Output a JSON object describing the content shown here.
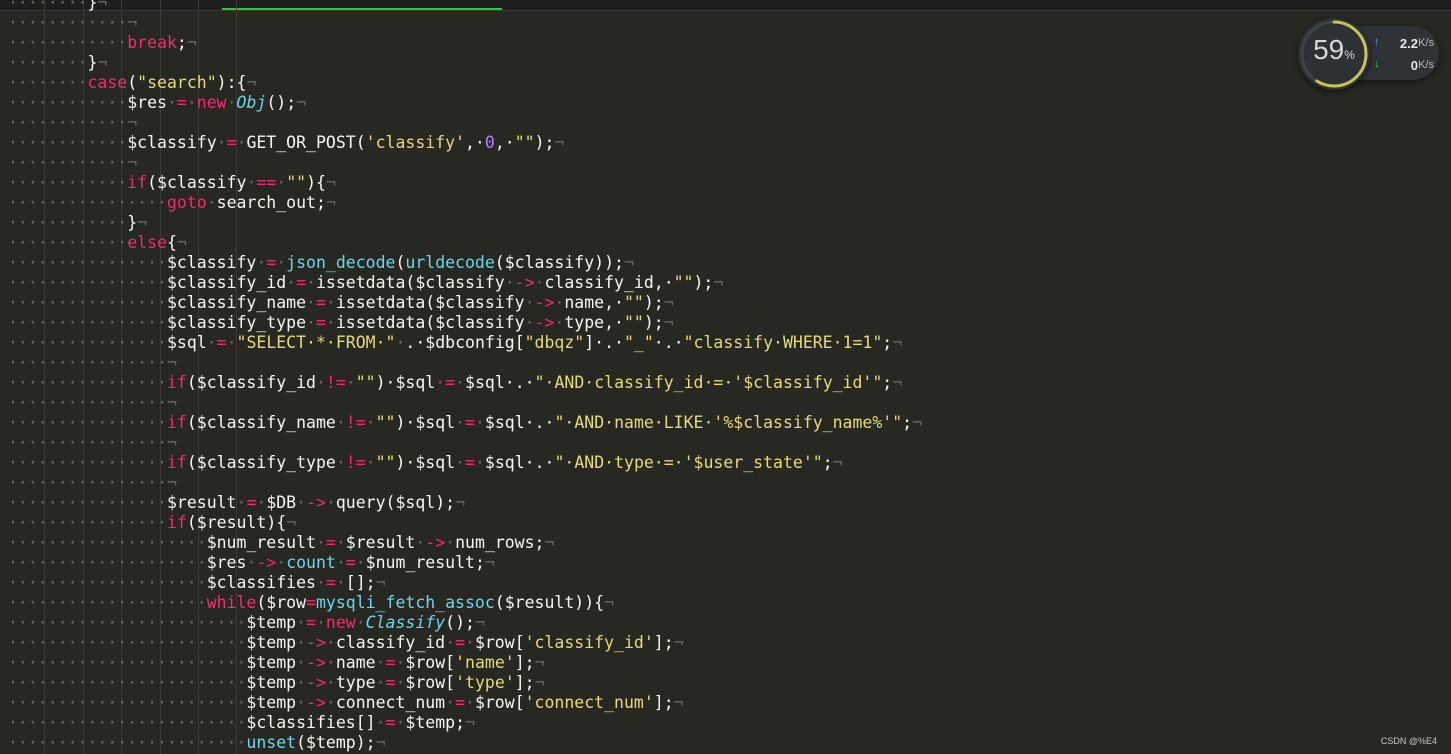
{
  "editor": {
    "lines": [
      {
        "indent": 2,
        "tokens": [
          [
            "plain",
            "}"
          ]
        ]
      },
      {
        "indent": 3,
        "tokens": []
      },
      {
        "indent": 3,
        "tokens": [
          [
            "kw",
            "break"
          ],
          [
            "plain",
            ";"
          ]
        ]
      },
      {
        "indent": 2,
        "tokens": [
          [
            "plain",
            "}"
          ]
        ]
      },
      {
        "indent": 2,
        "tokens": [
          [
            "kw",
            "case"
          ],
          [
            "plain",
            "("
          ],
          [
            "str",
            "\"search\""
          ],
          [
            "plain",
            "):{"
          ]
        ]
      },
      {
        "indent": 3,
        "tokens": [
          [
            "var",
            "$res"
          ],
          [
            "ws",
            "·"
          ],
          [
            "op",
            "="
          ],
          [
            "ws",
            "·"
          ],
          [
            "kw",
            "new"
          ],
          [
            "ws",
            "·"
          ],
          [
            "cls",
            "Obj"
          ],
          [
            "plain",
            "();"
          ]
        ]
      },
      {
        "indent": 3,
        "tokens": []
      },
      {
        "indent": 3,
        "tokens": [
          [
            "var",
            "$classify"
          ],
          [
            "ws",
            "·"
          ],
          [
            "op",
            "="
          ],
          [
            "ws",
            "·"
          ],
          [
            "plain",
            "GET_OR_POST("
          ],
          [
            "str",
            "'classify'"
          ],
          [
            "plain",
            ",·"
          ],
          [
            "num",
            "0"
          ],
          [
            "plain",
            ",·"
          ],
          [
            "str",
            "\"\""
          ],
          [
            "plain",
            ");"
          ]
        ]
      },
      {
        "indent": 3,
        "tokens": []
      },
      {
        "indent": 3,
        "tokens": [
          [
            "kw",
            "if"
          ],
          [
            "plain",
            "("
          ],
          [
            "var",
            "$classify"
          ],
          [
            "ws",
            "·"
          ],
          [
            "op",
            "=="
          ],
          [
            "ws",
            "·"
          ],
          [
            "str",
            "\"\""
          ],
          [
            "plain",
            "){"
          ]
        ]
      },
      {
        "indent": 4,
        "tokens": [
          [
            "kw",
            "goto"
          ],
          [
            "ws",
            "·"
          ],
          [
            "plain",
            "search_out;"
          ]
        ]
      },
      {
        "indent": 3,
        "tokens": [
          [
            "plain",
            "}"
          ]
        ]
      },
      {
        "indent": 3,
        "tokens": [
          [
            "kw",
            "else"
          ],
          [
            "plain",
            "{"
          ]
        ]
      },
      {
        "indent": 4,
        "tokens": [
          [
            "var",
            "$classify"
          ],
          [
            "ws",
            "·"
          ],
          [
            "op",
            "="
          ],
          [
            "ws",
            "·"
          ],
          [
            "fn",
            "json_decode"
          ],
          [
            "plain",
            "("
          ],
          [
            "fn",
            "urldecode"
          ],
          [
            "plain",
            "("
          ],
          [
            "var",
            "$classify"
          ],
          [
            "plain",
            "));"
          ]
        ]
      },
      {
        "indent": 4,
        "tokens": [
          [
            "var",
            "$classify_id"
          ],
          [
            "ws",
            "·"
          ],
          [
            "op",
            "="
          ],
          [
            "ws",
            "·"
          ],
          [
            "plain",
            "issetdata("
          ],
          [
            "var",
            "$classify"
          ],
          [
            "ws",
            "·"
          ],
          [
            "op",
            "->"
          ],
          [
            "ws",
            "·"
          ],
          [
            "plain",
            "classify_id,·"
          ],
          [
            "str",
            "\"\""
          ],
          [
            "plain",
            ");"
          ]
        ]
      },
      {
        "indent": 4,
        "tokens": [
          [
            "var",
            "$classify_name"
          ],
          [
            "ws",
            "·"
          ],
          [
            "op",
            "="
          ],
          [
            "ws",
            "·"
          ],
          [
            "plain",
            "issetdata("
          ],
          [
            "var",
            "$classify"
          ],
          [
            "ws",
            "·"
          ],
          [
            "op",
            "->"
          ],
          [
            "ws",
            "·"
          ],
          [
            "plain",
            "name,·"
          ],
          [
            "str",
            "\"\""
          ],
          [
            "plain",
            ");"
          ]
        ]
      },
      {
        "indent": 4,
        "tokens": [
          [
            "var",
            "$classify_type"
          ],
          [
            "ws",
            "·"
          ],
          [
            "op",
            "="
          ],
          [
            "ws",
            "·"
          ],
          [
            "plain",
            "issetdata("
          ],
          [
            "var",
            "$classify"
          ],
          [
            "ws",
            "·"
          ],
          [
            "op",
            "->"
          ],
          [
            "ws",
            "·"
          ],
          [
            "plain",
            "type,·"
          ],
          [
            "str",
            "\"\""
          ],
          [
            "plain",
            ");"
          ]
        ]
      },
      {
        "indent": 4,
        "tokens": [
          [
            "var",
            "$sql"
          ],
          [
            "ws",
            "·"
          ],
          [
            "op",
            "="
          ],
          [
            "ws",
            "·"
          ],
          [
            "str",
            "\"SELECT·*·FROM·\""
          ],
          [
            "ws",
            "·"
          ],
          [
            "plain",
            ".·"
          ],
          [
            "var",
            "$dbconfig"
          ],
          [
            "plain",
            "["
          ],
          [
            "str",
            "\"dbqz\""
          ],
          [
            "plain",
            "]·.·"
          ],
          [
            "str",
            "\"_\""
          ],
          [
            "plain",
            "·.·"
          ],
          [
            "str",
            "\"classify·WHERE·1=1\""
          ],
          [
            "plain",
            ";"
          ]
        ]
      },
      {
        "indent": 4,
        "tokens": []
      },
      {
        "indent": 4,
        "tokens": [
          [
            "kw",
            "if"
          ],
          [
            "plain",
            "("
          ],
          [
            "var",
            "$classify_id"
          ],
          [
            "ws",
            "·"
          ],
          [
            "op",
            "!="
          ],
          [
            "ws",
            "·"
          ],
          [
            "str",
            "\"\""
          ],
          [
            "plain",
            ")·"
          ],
          [
            "var",
            "$sql"
          ],
          [
            "ws",
            "·"
          ],
          [
            "op",
            "="
          ],
          [
            "ws",
            "·"
          ],
          [
            "var",
            "$sql"
          ],
          [
            "plain",
            "·.·"
          ],
          [
            "str",
            "\"·AND·classify_id·=·'$classify_id'\""
          ],
          [
            "plain",
            ";"
          ]
        ]
      },
      {
        "indent": 4,
        "tokens": []
      },
      {
        "indent": 4,
        "tokens": [
          [
            "kw",
            "if"
          ],
          [
            "plain",
            "("
          ],
          [
            "var",
            "$classify_name"
          ],
          [
            "ws",
            "·"
          ],
          [
            "op",
            "!="
          ],
          [
            "ws",
            "·"
          ],
          [
            "str",
            "\"\""
          ],
          [
            "plain",
            ")·"
          ],
          [
            "var",
            "$sql"
          ],
          [
            "ws",
            "·"
          ],
          [
            "op",
            "="
          ],
          [
            "ws",
            "·"
          ],
          [
            "var",
            "$sql"
          ],
          [
            "plain",
            "·.·"
          ],
          [
            "str",
            "\"·AND·name·LIKE·'%$classify_name%'\""
          ],
          [
            "plain",
            ";"
          ]
        ]
      },
      {
        "indent": 4,
        "tokens": []
      },
      {
        "indent": 4,
        "tokens": [
          [
            "kw",
            "if"
          ],
          [
            "plain",
            "("
          ],
          [
            "var",
            "$classify_type"
          ],
          [
            "ws",
            "·"
          ],
          [
            "op",
            "!="
          ],
          [
            "ws",
            "·"
          ],
          [
            "str",
            "\"\""
          ],
          [
            "plain",
            ")·"
          ],
          [
            "var",
            "$sql"
          ],
          [
            "ws",
            "·"
          ],
          [
            "op",
            "="
          ],
          [
            "ws",
            "·"
          ],
          [
            "var",
            "$sql"
          ],
          [
            "plain",
            "·.·"
          ],
          [
            "str",
            "\"·AND·type·=·'$user_state'\""
          ],
          [
            "plain",
            ";"
          ]
        ]
      },
      {
        "indent": 4,
        "tokens": []
      },
      {
        "indent": 4,
        "tokens": [
          [
            "var",
            "$result"
          ],
          [
            "ws",
            "·"
          ],
          [
            "op",
            "="
          ],
          [
            "ws",
            "·"
          ],
          [
            "var",
            "$DB"
          ],
          [
            "ws",
            "·"
          ],
          [
            "op",
            "->"
          ],
          [
            "ws",
            "·"
          ],
          [
            "plain",
            "query("
          ],
          [
            "var",
            "$sql"
          ],
          [
            "plain",
            ");"
          ]
        ]
      },
      {
        "indent": 4,
        "tokens": [
          [
            "kw",
            "if"
          ],
          [
            "plain",
            "("
          ],
          [
            "var",
            "$result"
          ],
          [
            "plain",
            "){"
          ]
        ]
      },
      {
        "indent": 5,
        "tokens": [
          [
            "var",
            "$num_result"
          ],
          [
            "ws",
            "·"
          ],
          [
            "op",
            "="
          ],
          [
            "ws",
            "·"
          ],
          [
            "var",
            "$result"
          ],
          [
            "ws",
            "·"
          ],
          [
            "op",
            "->"
          ],
          [
            "ws",
            "·"
          ],
          [
            "plain",
            "num_rows;"
          ]
        ]
      },
      {
        "indent": 5,
        "tokens": [
          [
            "var",
            "$res"
          ],
          [
            "ws",
            "·"
          ],
          [
            "op",
            "->"
          ],
          [
            "ws",
            "·"
          ],
          [
            "fn",
            "count"
          ],
          [
            "ws",
            "·"
          ],
          [
            "op",
            "="
          ],
          [
            "ws",
            "·"
          ],
          [
            "var",
            "$num_result"
          ],
          [
            "plain",
            ";"
          ]
        ]
      },
      {
        "indent": 5,
        "tokens": [
          [
            "var",
            "$classifies"
          ],
          [
            "ws",
            "·"
          ],
          [
            "op",
            "="
          ],
          [
            "ws",
            "·"
          ],
          [
            "plain",
            "[];"
          ]
        ]
      },
      {
        "indent": 5,
        "tokens": [
          [
            "kw",
            "while"
          ],
          [
            "plain",
            "("
          ],
          [
            "var",
            "$row"
          ],
          [
            "op",
            "="
          ],
          [
            "fn",
            "mysqli_fetch_assoc"
          ],
          [
            "plain",
            "("
          ],
          [
            "var",
            "$result"
          ],
          [
            "plain",
            ")){"
          ]
        ]
      },
      {
        "indent": 6,
        "tokens": [
          [
            "var",
            "$temp"
          ],
          [
            "ws",
            "·"
          ],
          [
            "op",
            "="
          ],
          [
            "ws",
            "·"
          ],
          [
            "kw",
            "new"
          ],
          [
            "ws",
            "·"
          ],
          [
            "cls",
            "Classify"
          ],
          [
            "plain",
            "();"
          ]
        ]
      },
      {
        "indent": 6,
        "tokens": [
          [
            "var",
            "$temp"
          ],
          [
            "ws",
            "·"
          ],
          [
            "op",
            "->"
          ],
          [
            "ws",
            "·"
          ],
          [
            "plain",
            "classify_id"
          ],
          [
            "ws",
            "·"
          ],
          [
            "op",
            "="
          ],
          [
            "ws",
            "·"
          ],
          [
            "var",
            "$row"
          ],
          [
            "plain",
            "["
          ],
          [
            "str",
            "'classify_id'"
          ],
          [
            "plain",
            "];"
          ]
        ]
      },
      {
        "indent": 6,
        "tokens": [
          [
            "var",
            "$temp"
          ],
          [
            "ws",
            "·"
          ],
          [
            "op",
            "->"
          ],
          [
            "ws",
            "·"
          ],
          [
            "plain",
            "name"
          ],
          [
            "ws",
            "·"
          ],
          [
            "op",
            "="
          ],
          [
            "ws",
            "·"
          ],
          [
            "var",
            "$row"
          ],
          [
            "plain",
            "["
          ],
          [
            "str",
            "'name'"
          ],
          [
            "plain",
            "];"
          ]
        ]
      },
      {
        "indent": 6,
        "tokens": [
          [
            "var",
            "$temp"
          ],
          [
            "ws",
            "·"
          ],
          [
            "op",
            "->"
          ],
          [
            "ws",
            "·"
          ],
          [
            "plain",
            "type"
          ],
          [
            "ws",
            "·"
          ],
          [
            "op",
            "="
          ],
          [
            "ws",
            "·"
          ],
          [
            "var",
            "$row"
          ],
          [
            "plain",
            "["
          ],
          [
            "str",
            "'type'"
          ],
          [
            "plain",
            "];"
          ]
        ]
      },
      {
        "indent": 6,
        "tokens": [
          [
            "var",
            "$temp"
          ],
          [
            "ws",
            "·"
          ],
          [
            "op",
            "->"
          ],
          [
            "ws",
            "·"
          ],
          [
            "plain",
            "connect_num"
          ],
          [
            "ws",
            "·"
          ],
          [
            "op",
            "="
          ],
          [
            "ws",
            "·"
          ],
          [
            "var",
            "$row"
          ],
          [
            "plain",
            "["
          ],
          [
            "str",
            "'connect_num'"
          ],
          [
            "plain",
            "];"
          ]
        ]
      },
      {
        "indent": 6,
        "tokens": [
          [
            "var",
            "$classifies"
          ],
          [
            "plain",
            "[]"
          ],
          [
            "ws",
            "·"
          ],
          [
            "op",
            "="
          ],
          [
            "ws",
            "·"
          ],
          [
            "var",
            "$temp"
          ],
          [
            "plain",
            ";"
          ]
        ]
      },
      {
        "indent": 6,
        "tokens": [
          [
            "fn",
            "unset"
          ],
          [
            "plain",
            "("
          ],
          [
            "var",
            "$temp"
          ],
          [
            "plain",
            ");"
          ]
        ]
      }
    ],
    "eol_marker": "¬"
  },
  "net_widget": {
    "usage_percent": "59",
    "usage_unit": "%",
    "usage_fraction": 0.59,
    "upload_speed": "2.2",
    "upload_unit": "K/s",
    "download_speed": "0",
    "download_unit": "K/s",
    "up_icon": "arrow-up-icon",
    "down_icon": "arrow-down-icon"
  },
  "watermark": "CSDN @%E4",
  "colors": {
    "background": "#272822",
    "keyword": "#f92672",
    "string": "#e6db74",
    "function": "#66d9ef",
    "number": "#ae81ff",
    "tab_indicator": "#27c93f"
  }
}
